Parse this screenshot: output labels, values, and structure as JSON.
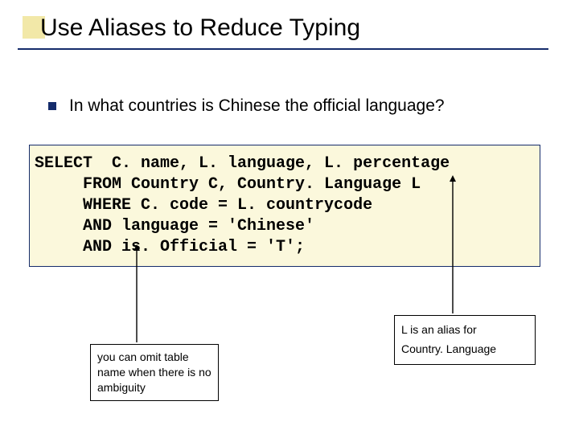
{
  "title": "Use Aliases to Reduce Typing",
  "bullet": "In what countries is Chinese the official language?",
  "code": {
    "l1": "SELECT  C. name, L. language, L. percentage",
    "l2": "     FROM Country C, Country. Language L",
    "l3": "     WHERE C. code = L. countrycode",
    "l4": "     AND language = 'Chinese'",
    "l5": "     AND is. Official = 'T';"
  },
  "note_omit": "you can omit table name when there is no ambiguity",
  "note_alias_line1": "L is an alias for",
  "note_alias_line2": "Country. Language"
}
